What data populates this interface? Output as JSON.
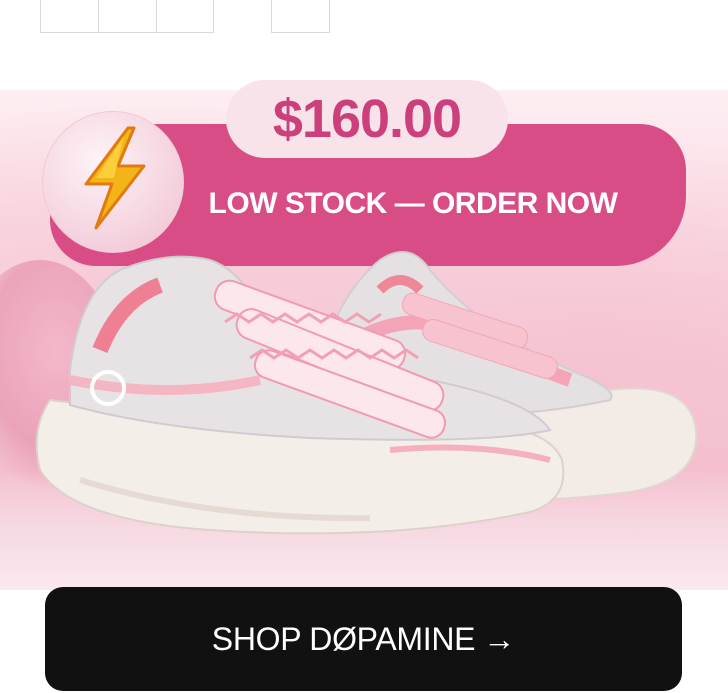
{
  "promo": {
    "price": "$160.00",
    "stock_message": "LOW STOCK — ORDER NOW",
    "icon": "lightning-bolt-icon"
  },
  "product": {
    "image": "pink-white-chunky-sneaker-image"
  },
  "cta": {
    "label": "SHOP DØPAMINE",
    "arrow": "→"
  },
  "colors": {
    "accent_pink": "#d94d87",
    "price_pink": "#cc3f7b",
    "pill_bg": "#f9e3ea",
    "cta_bg": "#111111",
    "cta_text": "#ffffff"
  }
}
